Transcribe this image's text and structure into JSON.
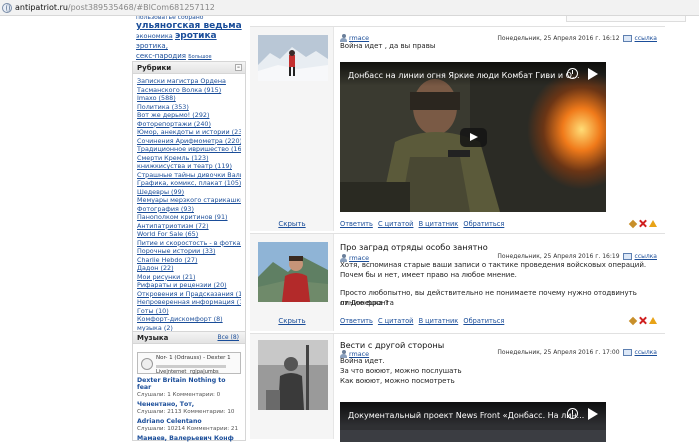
{
  "address": {
    "host": "antipatriot.ru",
    "path": "/post389535468/#BlCom681257112"
  },
  "tags": {
    "line0": "пользоватье собрано",
    "line1": "ульяногская ведьма",
    "line2a": "экономика",
    "line2b": "эротика",
    "line2c": "эротика,",
    "line3a": "секс-пародия",
    "line3b": "Большое"
  },
  "rubrics": {
    "title": "Рубрики",
    "items": [
      "Записки магистра Ордена",
      "Тасманского Волка (915)",
      "Imaxo (588)",
      "Политика (353)",
      "Вот же дерьмо! (292)",
      "Фоторепортажи (240)",
      "Юмор, анекдоты и истории (233)",
      "Сочинения Арифмометра (220)",
      "Традиционное ивришество (166)",
      "Смерти Кремль (123)",
      "книжкисуства и театр (119)",
      "Страшные тайны дивочки Вали (111)",
      "Графика, комикс, плакат (105)",
      "Шедевры (99)",
      "Мемуары мерзкого старикашки (95)",
      "Фотография (93)",
      "Панополком критинов (91)",
      "Антипатриотизм (72)",
      "World For Sale (65)",
      "Питие и скоростость - в фотках (55)",
      "Порочные истории (33)",
      "Charlie Hebdo (27)",
      "Дадон (22)",
      "Мои рисунки (21)",
      "Рифараты и рецензии (20)",
      "Откровения и Прадсказания (17)",
      "Непроверенная информация (15)",
      "Готы (10)",
      "Комфорт-дискомфорт (8)",
      "музыка (2)"
    ]
  },
  "music": {
    "title": "Музыка",
    "all": "Все (8)",
    "player_line1": "Nor- 1 (Odrauss) - Dexter 1",
    "player_line2": "Live|nternet",
    "player_line3": "rg|pa|umbs",
    "items": [
      {
        "title": "Dexter Britain Nothing to fear",
        "stats": "Слушали: 1  Комментарии: 0"
      },
      {
        "title": "Ченентано, Тот,",
        "stats": "Слушали: 2113  Комментарии: 10"
      },
      {
        "title": "Adriano Celentano",
        "stats": "Слушали: 10214  Комментарии: 21"
      },
      {
        "title": "Мамаев, Валерьевич Конф",
        "stats": ""
      }
    ]
  },
  "posts": [
    {
      "author": "rmace",
      "date": "Понедельник, 25 Апреля 2016 г. 16:12",
      "ref": "ссылка",
      "text": "Война идет , да вы правы",
      "video_title": "Донбасс на линии огня Яркие люди Комбат Гиви и О...",
      "hide": "Скрыть",
      "actions": [
        "Ответить",
        "С цитатой",
        "В цитатник",
        "Обратиться"
      ]
    },
    {
      "title": "Про заград отряды особо занятно",
      "author": "rmace",
      "date": "Понедельник, 25 Апреля 2016 г. 16:19",
      "ref": "ссылка",
      "text1": "Хотя, вспоминая старые ваши записи о тактике проведения войсковых операций.",
      "text2": "Почем бы и нет, имеет право на любое мнение.",
      "text3": "Просто любопытно, вы действительно не понимаете почему нужно отодвинуть линию фронта",
      "text4": "от Донецка ?",
      "hide": "Скрыть",
      "actions": [
        "Ответить",
        "С цитатой",
        "В цитатник",
        "Обратиться"
      ]
    },
    {
      "title": "Вести с другой стороны",
      "author": "rmace",
      "date": "Понедельник, 25 Апреля 2016 г. 17:00",
      "ref": "ссылка",
      "text1": "Война идет.",
      "text2": "За что воюют, можно послушать",
      "text3": "Как воюют, можно посмотреть",
      "video_title": "Документальный проект News Front «Донбасс. На лин..."
    }
  ]
}
